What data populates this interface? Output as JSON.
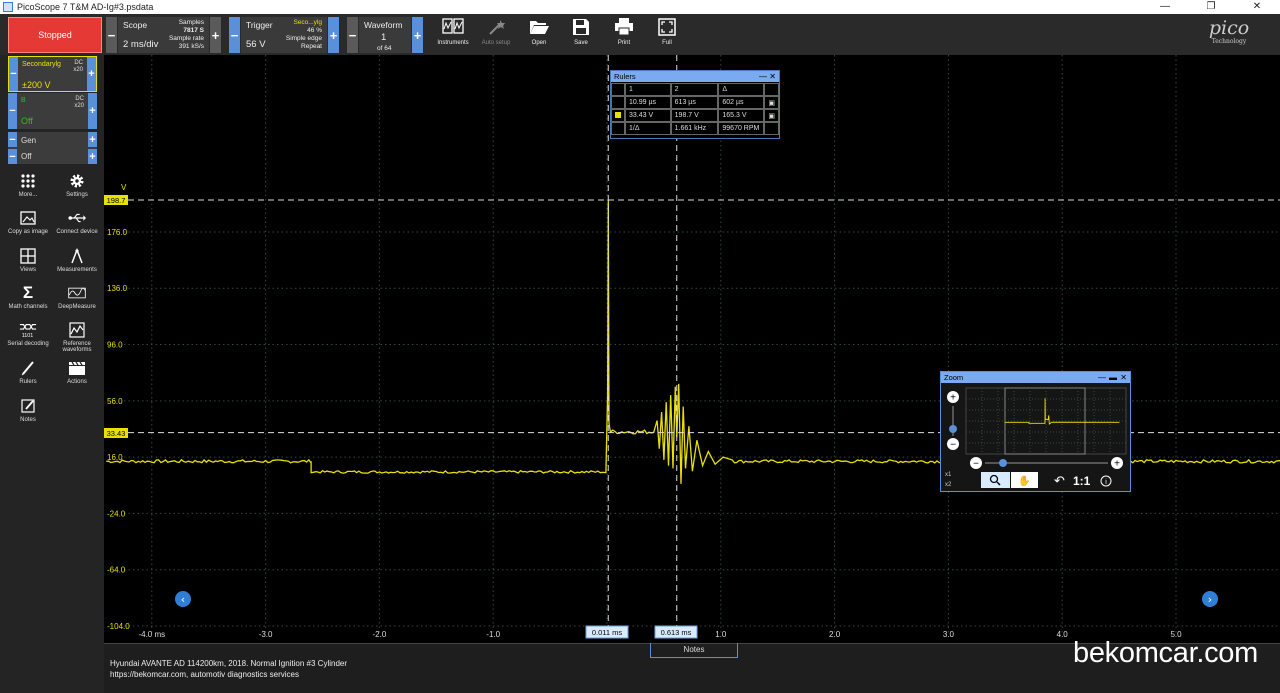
{
  "window": {
    "title": "PicoScope 7 T&M AD-Ig#3.psdata",
    "min_glyph": "—",
    "max_glyph": "❐",
    "close_glyph": "✕"
  },
  "toolbar": {
    "run_state": "Stopped",
    "scope": {
      "label": "Scope",
      "value": "2 ms/div",
      "samples_label": "Samples",
      "samples_value": "7817 S",
      "rate_label": "Sample rate",
      "rate_value": "391 kS/s"
    },
    "trigger": {
      "label": "Trigger",
      "value": "56 V",
      "source": "Seco...ylg",
      "percent": "46 %",
      "mode": "Simple edge",
      "repeat": "Repeat"
    },
    "waveform": {
      "label": "Waveform",
      "value": "1",
      "of": "of 64"
    },
    "buttons": {
      "instruments": "Instruments",
      "auto_setup": "Auto setup",
      "open": "Open",
      "save": "Save",
      "print": "Print",
      "full": "Full"
    },
    "logo": {
      "name": "pico",
      "sub": "Technology"
    }
  },
  "channels": [
    {
      "name": "Secondarylg",
      "coupling": "DC",
      "probe": "x20",
      "range": "±200 V",
      "color": "#e8e000"
    },
    {
      "name": "B",
      "coupling": "DC",
      "probe": "x20",
      "range": "Off",
      "color": "#27c21f"
    },
    {
      "name": "Gen",
      "range": "Off"
    }
  ],
  "sidebar": {
    "more": "More...",
    "settings": "Settings",
    "copy_as_image": "Copy as image",
    "connect_device": "Connect device",
    "views": "Views",
    "measurements": "Measurements",
    "math_channels": "Math channels",
    "deepmeasure": "DeepMeasure",
    "serial_decoding": "Serial decoding",
    "reference_waveforms": "Reference waveforms",
    "rulers": "Rulers",
    "actions": "Actions",
    "notes": "Notes"
  },
  "plot": {
    "y_unit": "V",
    "y_ticks": [
      "176.0",
      "136.0",
      "96.0",
      "56.0",
      "16.0",
      "-24.0",
      "-64.0",
      "-104.0"
    ],
    "y_tick_values": [
      176,
      136,
      96,
      56,
      16,
      -24,
      -64,
      -104
    ],
    "x_ticks": [
      "-4.0 ms",
      "-3.0",
      "-2.0",
      "-1.0",
      "1.0",
      "2.0",
      "3.0",
      "4.0",
      "5.0"
    ],
    "x_tick_values": [
      -4,
      -3,
      -2,
      -1,
      1,
      2,
      3,
      4,
      5
    ],
    "ruler_h1_label": "198.7",
    "ruler_h2_label": "33.43",
    "ruler_v1_label": "0.011 ms",
    "ruler_v2_label": "0.613 ms",
    "trace_color": "#e8e000",
    "arrow_left": "‹",
    "arrow_right": "›"
  },
  "rulers_window": {
    "title": "Rulers",
    "col1": "1",
    "col2": "2",
    "delta": "Δ",
    "time_1": "10.99 µs",
    "time_2": "613 µs",
    "time_delta": "602 µs",
    "volt_1": "33.43 V",
    "volt_2": "198.7 V",
    "volt_delta": "165.3 V",
    "inv_label": "1/Δ",
    "freq": "1.661 kHz",
    "rpm": "99670 RPM"
  },
  "zoom_window": {
    "title": "Zoom",
    "x1": "x1",
    "x2": "x2",
    "ratio": "1:1",
    "info": "i"
  },
  "notes": {
    "tab": "Notes",
    "line1": "Hyundai AVANTE AD 114200km, 2018. Normal Ignition #3 Cylinder",
    "line2": "https://bekomcar.com, automotiv diagnostics services",
    "watermark": "bekomcar.com"
  }
}
